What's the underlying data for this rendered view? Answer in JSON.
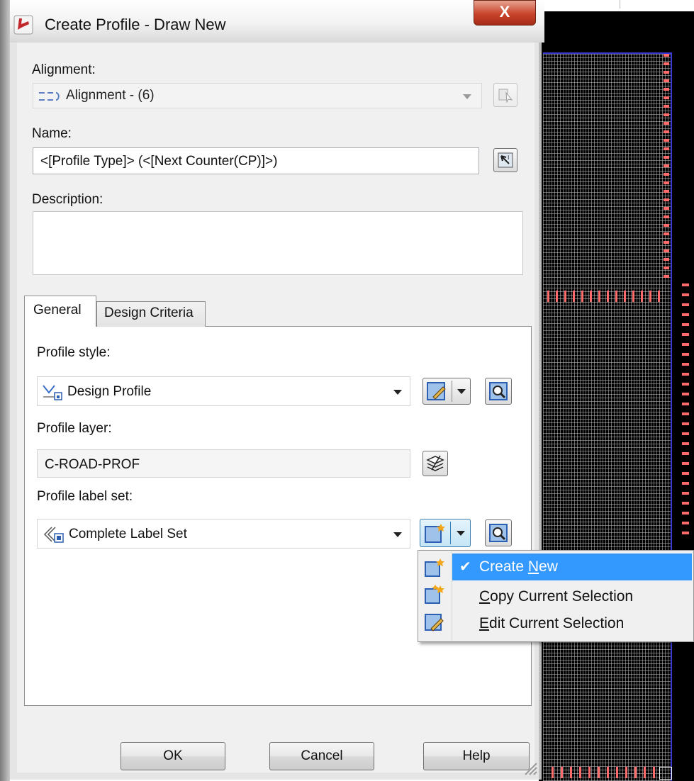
{
  "window": {
    "title": "Create Profile - Draw New",
    "close_glyph": "X"
  },
  "alignment": {
    "label": "Alignment:",
    "value": "Alignment - (6)"
  },
  "name": {
    "label": "Name:",
    "value": "<[Profile Type]> (<[Next Counter(CP)]>)"
  },
  "description": {
    "label": "Description:",
    "value": ""
  },
  "tabs": [
    {
      "label": "General",
      "active": true
    },
    {
      "label": "Design Criteria",
      "active": false
    }
  ],
  "general": {
    "profile_style_label": "Profile style:",
    "profile_style_value": "Design Profile",
    "profile_layer_label": "Profile layer:",
    "profile_layer_value": "C-ROAD-PROF",
    "label_set_label": "Profile label set:",
    "label_set_value": "Complete Label Set"
  },
  "menu": {
    "items": [
      {
        "pre": "Create ",
        "key": "N",
        "post": "ew",
        "checked": true,
        "icon": "create-new-icon"
      },
      {
        "pre": "",
        "key": "C",
        "post": "opy Current Selection",
        "checked": false,
        "icon": "copy-selection-icon"
      },
      {
        "pre": "",
        "key": "E",
        "post": "dit Current Selection",
        "checked": false,
        "icon": "edit-selection-icon"
      }
    ],
    "check_glyph": "✔"
  },
  "buttons": {
    "ok": "OK",
    "cancel": "Cancel",
    "help": "Help"
  },
  "colors": {
    "menu_highlight": "#3399ff",
    "close_button": "#c9442c",
    "cad_background": "#000000",
    "cad_markers": "#ff6a6a",
    "cad_border": "#3a3ad6"
  }
}
